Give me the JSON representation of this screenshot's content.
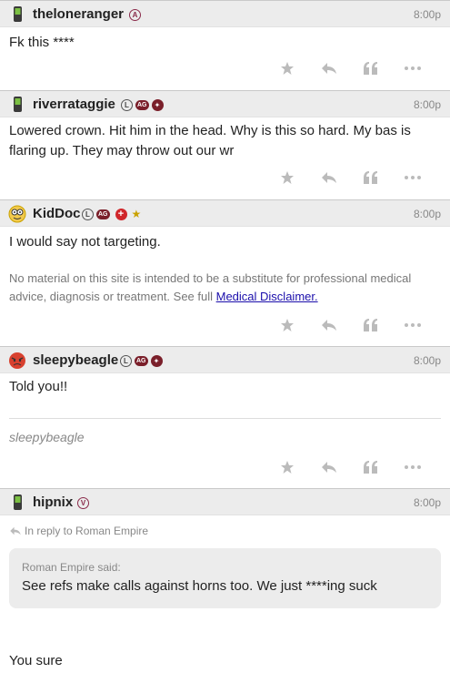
{
  "posts": [
    {
      "username": "theloneranger",
      "time": "8:00p",
      "badges": [
        "A"
      ],
      "body": "Fk this ****"
    },
    {
      "username": "riverrataggie",
      "time": "8:00p",
      "badges": [
        "L",
        "AG",
        "horns"
      ],
      "body": "Lowered crown. Hit him in the head. Why is this so hard. My bas is flaring up. They may throw out our wr"
    },
    {
      "username": "KidDoc",
      "time": "8:00p",
      "badges": [
        "L",
        "AG",
        "medical",
        "star"
      ],
      "body": "I would say not targeting.",
      "disclaimer_text": "No material on this site is intended to be a substitute for professional medical advice, diagnosis or treatment. See full ",
      "disclaimer_link": "Medical Disclaimer."
    },
    {
      "username": "sleepybeagle",
      "time": "8:00p",
      "badges": [
        "L",
        "AG",
        "horns"
      ],
      "body": "Told you!!",
      "signature": "sleepybeagle"
    },
    {
      "username": "hipnix",
      "time": "8:00p",
      "badges": [
        "V"
      ],
      "reply_context": "In reply to Roman Empire",
      "quote_author": "Roman Empire said:",
      "quote_text": "See refs make calls against horns too. We just ****ing suck",
      "body": "You sure"
    }
  ],
  "badge_text": {
    "L": "L",
    "AG": "AG",
    "A": "A",
    "V": "V"
  },
  "colors": {
    "header_bg": "#ececec",
    "maroon": "#7a1f2a",
    "link": "#1a0dab",
    "action_icon": "#bbbbbb"
  },
  "actions": [
    "star-icon",
    "reply-icon",
    "quote-icon",
    "more-icon"
  ]
}
